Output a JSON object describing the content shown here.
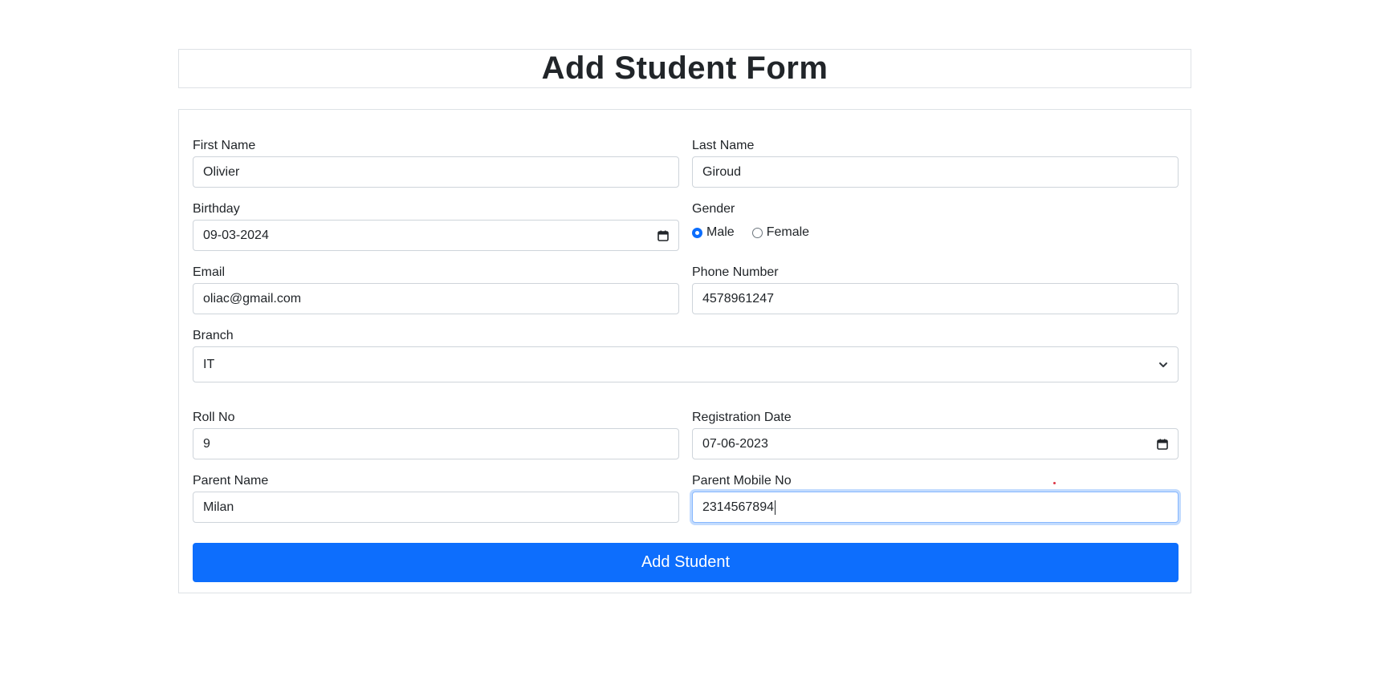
{
  "page": {
    "title": "Add Student Form"
  },
  "form": {
    "first_name": {
      "label": "First Name",
      "value": "Olivier"
    },
    "last_name": {
      "label": "Last Name",
      "value": "Giroud"
    },
    "birthday": {
      "label": "Birthday",
      "value": "09-03-2024"
    },
    "gender": {
      "label": "Gender",
      "options": [
        "Male",
        "Female"
      ],
      "selected": "Male"
    },
    "email": {
      "label": "Email",
      "value": "oliac@gmail.com"
    },
    "phone": {
      "label": "Phone Number",
      "value": "4578961247"
    },
    "branch": {
      "label": "Branch",
      "selected": "IT"
    },
    "roll_no": {
      "label": "Roll No",
      "value": "9"
    },
    "registration_date": {
      "label": "Registration Date",
      "value": "07-06-2023"
    },
    "parent_name": {
      "label": "Parent Name",
      "value": "Milan"
    },
    "parent_mobile": {
      "label": "Parent Mobile No",
      "value": "2314567894"
    },
    "submit_label": "Add Student"
  },
  "colors": {
    "primary": "#0d6efd",
    "border": "#dee2e6",
    "input_border": "#ced4da",
    "text": "#212529",
    "focus_border": "#86b7fe"
  },
  "icons": {
    "calendar": "calendar-icon",
    "select": "chevron-down-icon"
  }
}
